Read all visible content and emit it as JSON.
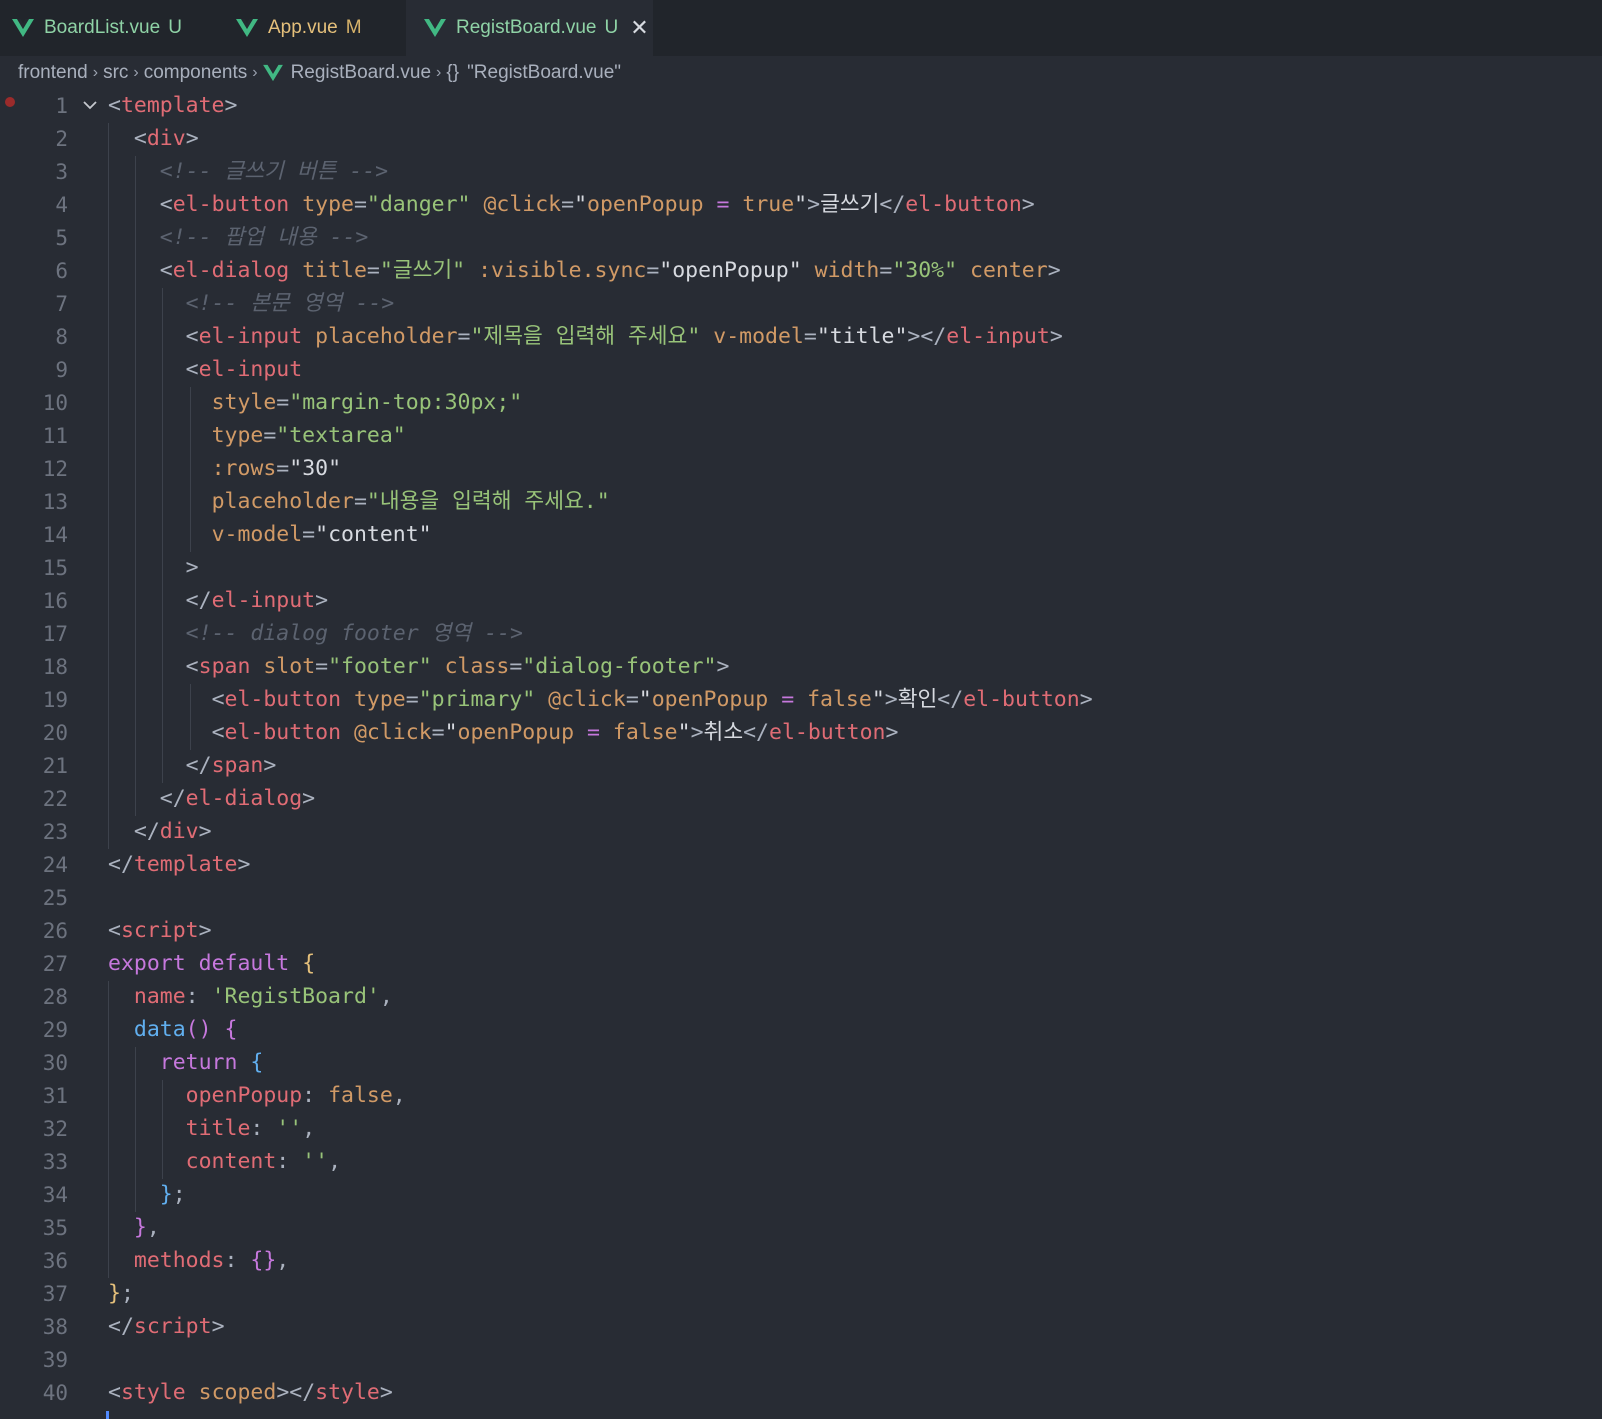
{
  "tabs": [
    {
      "label": "BoardList.vue",
      "status": "U",
      "color": "#8fd3a6",
      "status_color": "#8fd3a6"
    },
    {
      "label": "App.vue",
      "status": "M",
      "color": "#e5c07b",
      "status_color": "#d7b36a"
    },
    {
      "label": "RegistBoard.vue",
      "status": "U",
      "color": "#8fd3a6",
      "status_color": "#8fd3a6",
      "active": true,
      "close": "✕"
    }
  ],
  "breadcrumb": {
    "items": [
      "frontend",
      "src",
      "components",
      "RegistBoard.vue",
      "\"RegistBoard.vue\""
    ],
    "separator": "›",
    "braces": "{}"
  },
  "colors": {
    "tag": "#e06c75",
    "attribute": "#d19a66",
    "string": "#98c379",
    "comment": "#5c6370",
    "keyword": "#c678dd",
    "function": "#61afef",
    "vue_icon": "#41b883"
  },
  "editor": {
    "breakpoint_line": 1,
    "lines": [
      [
        [
          "br",
          "<"
        ],
        [
          "tg",
          "template"
        ],
        [
          "br",
          ">"
        ]
      ],
      [
        [
          "pl",
          "  "
        ],
        [
          "br",
          "<"
        ],
        [
          "tg",
          "div"
        ],
        [
          "br",
          ">"
        ]
      ],
      [
        [
          "pl",
          "    "
        ],
        [
          "cm",
          "<!-- 글쓰기 버튼 -->"
        ]
      ],
      [
        [
          "pl",
          "    "
        ],
        [
          "br",
          "<"
        ],
        [
          "tg",
          "el-button"
        ],
        [
          "pl",
          " "
        ],
        [
          "at",
          "type"
        ],
        [
          "br",
          "="
        ],
        [
          "st",
          "\"danger\""
        ],
        [
          "pl",
          " "
        ],
        [
          "at",
          "@click"
        ],
        [
          "br",
          "="
        ],
        [
          "pl",
          "\""
        ],
        [
          "at",
          "openPopup"
        ],
        [
          "pl",
          " "
        ],
        [
          "kw",
          "="
        ],
        [
          "pl",
          " "
        ],
        [
          "at",
          "true"
        ],
        [
          "pl",
          "\""
        ],
        [
          "br",
          ">"
        ],
        [
          "pl",
          "글쓰기"
        ],
        [
          "br",
          "</"
        ],
        [
          "tg",
          "el-button"
        ],
        [
          "br",
          ">"
        ]
      ],
      [
        [
          "pl",
          "    "
        ],
        [
          "cm",
          "<!-- 팝업 내용 -->"
        ]
      ],
      [
        [
          "pl",
          "    "
        ],
        [
          "br",
          "<"
        ],
        [
          "tg",
          "el-dialog"
        ],
        [
          "pl",
          " "
        ],
        [
          "at",
          "title"
        ],
        [
          "br",
          "="
        ],
        [
          "st",
          "\"글쓰기\""
        ],
        [
          "pl",
          " "
        ],
        [
          "at",
          ":visible.sync"
        ],
        [
          "br",
          "="
        ],
        [
          "pl",
          "\"openPopup\""
        ],
        [
          "pl",
          " "
        ],
        [
          "at",
          "width"
        ],
        [
          "br",
          "="
        ],
        [
          "st",
          "\"30%\""
        ],
        [
          "pl",
          " "
        ],
        [
          "at",
          "center"
        ],
        [
          "br",
          ">"
        ]
      ],
      [
        [
          "pl",
          "      "
        ],
        [
          "cm",
          "<!-- 본문 영역 -->"
        ]
      ],
      [
        [
          "pl",
          "      "
        ],
        [
          "br",
          "<"
        ],
        [
          "tg",
          "el-input"
        ],
        [
          "pl",
          " "
        ],
        [
          "at",
          "placeholder"
        ],
        [
          "br",
          "="
        ],
        [
          "st",
          "\"제목을 입력해 주세요\""
        ],
        [
          "pl",
          " "
        ],
        [
          "at",
          "v-model"
        ],
        [
          "br",
          "="
        ],
        [
          "pl",
          "\"title\""
        ],
        [
          "br",
          "></"
        ],
        [
          "tg",
          "el-input"
        ],
        [
          "br",
          ">"
        ]
      ],
      [
        [
          "pl",
          "      "
        ],
        [
          "br",
          "<"
        ],
        [
          "tg",
          "el-input"
        ]
      ],
      [
        [
          "pl",
          "        "
        ],
        [
          "at",
          "style"
        ],
        [
          "br",
          "="
        ],
        [
          "st",
          "\"margin-top:30px;\""
        ]
      ],
      [
        [
          "pl",
          "        "
        ],
        [
          "at",
          "type"
        ],
        [
          "br",
          "="
        ],
        [
          "st",
          "\"textarea\""
        ]
      ],
      [
        [
          "pl",
          "        "
        ],
        [
          "at",
          ":rows"
        ],
        [
          "br",
          "="
        ],
        [
          "pl",
          "\"30\""
        ]
      ],
      [
        [
          "pl",
          "        "
        ],
        [
          "at",
          "placeholder"
        ],
        [
          "br",
          "="
        ],
        [
          "st",
          "\"내용을 입력해 주세요.\""
        ]
      ],
      [
        [
          "pl",
          "        "
        ],
        [
          "at",
          "v-model"
        ],
        [
          "br",
          "="
        ],
        [
          "pl",
          "\"content\""
        ]
      ],
      [
        [
          "pl",
          "      "
        ],
        [
          "br",
          ">"
        ]
      ],
      [
        [
          "pl",
          "      "
        ],
        [
          "br",
          "</"
        ],
        [
          "tg",
          "el-input"
        ],
        [
          "br",
          ">"
        ]
      ],
      [
        [
          "pl",
          "      "
        ],
        [
          "cm",
          "<!-- dialog footer 영역 -->"
        ]
      ],
      [
        [
          "pl",
          "      "
        ],
        [
          "br",
          "<"
        ],
        [
          "tg",
          "span"
        ],
        [
          "pl",
          " "
        ],
        [
          "at",
          "slot"
        ],
        [
          "br",
          "="
        ],
        [
          "st",
          "\"footer\""
        ],
        [
          "pl",
          " "
        ],
        [
          "at",
          "class"
        ],
        [
          "br",
          "="
        ],
        [
          "st",
          "\"dialog-footer\""
        ],
        [
          "br",
          ">"
        ]
      ],
      [
        [
          "pl",
          "        "
        ],
        [
          "br",
          "<"
        ],
        [
          "tg",
          "el-button"
        ],
        [
          "pl",
          " "
        ],
        [
          "at",
          "type"
        ],
        [
          "br",
          "="
        ],
        [
          "st",
          "\"primary\""
        ],
        [
          "pl",
          " "
        ],
        [
          "at",
          "@click"
        ],
        [
          "br",
          "="
        ],
        [
          "pl",
          "\""
        ],
        [
          "at",
          "openPopup"
        ],
        [
          "pl",
          " "
        ],
        [
          "kw",
          "="
        ],
        [
          "pl",
          " "
        ],
        [
          "at",
          "false"
        ],
        [
          "pl",
          "\""
        ],
        [
          "br",
          ">"
        ],
        [
          "pl",
          "확인"
        ],
        [
          "br",
          "</"
        ],
        [
          "tg",
          "el-button"
        ],
        [
          "br",
          ">"
        ]
      ],
      [
        [
          "pl",
          "        "
        ],
        [
          "br",
          "<"
        ],
        [
          "tg",
          "el-button"
        ],
        [
          "pl",
          " "
        ],
        [
          "at",
          "@click"
        ],
        [
          "br",
          "="
        ],
        [
          "pl",
          "\""
        ],
        [
          "at",
          "openPopup"
        ],
        [
          "pl",
          " "
        ],
        [
          "kw",
          "="
        ],
        [
          "pl",
          " "
        ],
        [
          "at",
          "false"
        ],
        [
          "pl",
          "\""
        ],
        [
          "br",
          ">"
        ],
        [
          "pl",
          "취소"
        ],
        [
          "br",
          "</"
        ],
        [
          "tg",
          "el-button"
        ],
        [
          "br",
          ">"
        ]
      ],
      [
        [
          "pl",
          "      "
        ],
        [
          "br",
          "</"
        ],
        [
          "tg",
          "span"
        ],
        [
          "br",
          ">"
        ]
      ],
      [
        [
          "pl",
          "    "
        ],
        [
          "br",
          "</"
        ],
        [
          "tg",
          "el-dialog"
        ],
        [
          "br",
          ">"
        ]
      ],
      [
        [
          "pl",
          "  "
        ],
        [
          "br",
          "</"
        ],
        [
          "tg",
          "div"
        ],
        [
          "br",
          ">"
        ]
      ],
      [
        [
          "br",
          "</"
        ],
        [
          "tg",
          "template"
        ],
        [
          "br",
          ">"
        ]
      ],
      [],
      [
        [
          "br",
          "<"
        ],
        [
          "tg",
          "script"
        ],
        [
          "br",
          ">"
        ]
      ],
      [
        [
          "kw",
          "export"
        ],
        [
          "pl",
          " "
        ],
        [
          "kw",
          "default"
        ],
        [
          "pl",
          " "
        ],
        [
          "y1",
          "{"
        ]
      ],
      [
        [
          "pl",
          "  "
        ],
        [
          "tg",
          "name"
        ],
        [
          "br",
          ": "
        ],
        [
          "st",
          "'RegistBoard'"
        ],
        [
          "br",
          ","
        ]
      ],
      [
        [
          "pl",
          "  "
        ],
        [
          "fn",
          "data"
        ],
        [
          "p2",
          "()"
        ],
        [
          "pl",
          " "
        ],
        [
          "p2",
          "{"
        ]
      ],
      [
        [
          "pl",
          "    "
        ],
        [
          "kw",
          "return"
        ],
        [
          "pl",
          " "
        ],
        [
          "b3",
          "{"
        ]
      ],
      [
        [
          "pl",
          "      "
        ],
        [
          "tg",
          "openPopup"
        ],
        [
          "br",
          ": "
        ],
        [
          "nu",
          "false"
        ],
        [
          "br",
          ","
        ]
      ],
      [
        [
          "pl",
          "      "
        ],
        [
          "tg",
          "title"
        ],
        [
          "br",
          ": "
        ],
        [
          "st",
          "''"
        ],
        [
          "br",
          ","
        ]
      ],
      [
        [
          "pl",
          "      "
        ],
        [
          "tg",
          "content"
        ],
        [
          "br",
          ": "
        ],
        [
          "st",
          "''"
        ],
        [
          "br",
          ","
        ]
      ],
      [
        [
          "pl",
          "    "
        ],
        [
          "b3",
          "}"
        ],
        [
          "br",
          ";"
        ]
      ],
      [
        [
          "pl",
          "  "
        ],
        [
          "p2",
          "}"
        ],
        [
          "br",
          ","
        ]
      ],
      [
        [
          "pl",
          "  "
        ],
        [
          "tg",
          "methods"
        ],
        [
          "br",
          ": "
        ],
        [
          "p2",
          "{}"
        ],
        [
          "br",
          ","
        ]
      ],
      [
        [
          "y1",
          "}"
        ],
        [
          "br",
          ";"
        ]
      ],
      [
        [
          "br",
          "</"
        ],
        [
          "tg",
          "script"
        ],
        [
          "br",
          ">"
        ]
      ],
      [],
      [
        [
          "br",
          "<"
        ],
        [
          "tg",
          "style"
        ],
        [
          "pl",
          " "
        ],
        [
          "at",
          "scoped"
        ],
        [
          "br",
          "></"
        ],
        [
          "tg",
          "style"
        ],
        [
          "br",
          ">"
        ]
      ]
    ]
  }
}
